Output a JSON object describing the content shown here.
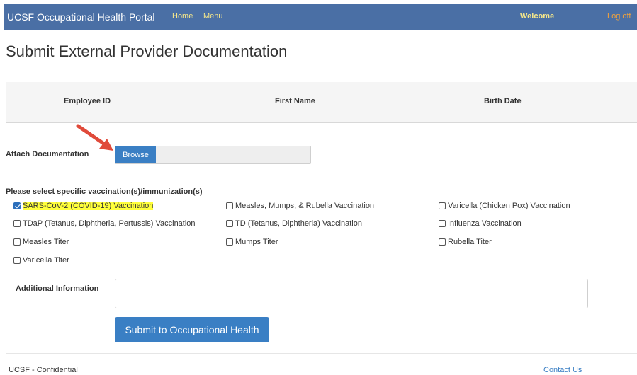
{
  "navbar": {
    "brand": "UCSF Occupational Health Portal",
    "links": [
      "Home",
      "Menu"
    ],
    "welcome": "Welcome",
    "logoff": "Log off"
  },
  "page": {
    "title": "Submit External Provider Documentation"
  },
  "employee_panel": {
    "columns": [
      "Employee ID",
      "First Name",
      "Birth Date"
    ]
  },
  "attach": {
    "label": "Attach Documentation",
    "browse_label": "Browse"
  },
  "vaccinations": {
    "title": "Please select specific vaccination(s)/immunization(s)",
    "items": [
      {
        "label": "SARS-CoV-2 (COVID-19) Vaccination",
        "checked": true
      },
      {
        "label": "Measles, Mumps, & Rubella Vaccination",
        "checked": false
      },
      {
        "label": "Varicella (Chicken Pox) Vaccination",
        "checked": false
      },
      {
        "label": "TDaP (Tetanus, Diphtheria, Pertussis) Vaccination",
        "checked": false
      },
      {
        "label": "TD (Tetanus, Diphtheria) Vaccination",
        "checked": false
      },
      {
        "label": "Influenza Vaccination",
        "checked": false
      },
      {
        "label": "Measles Titer",
        "checked": false
      },
      {
        "label": "Mumps Titer",
        "checked": false
      },
      {
        "label": "Rubella Titer",
        "checked": false
      },
      {
        "label": "Varicella Titer",
        "checked": false
      }
    ]
  },
  "additional": {
    "label": "Additional Information",
    "value": ""
  },
  "submit": {
    "label": "Submit to Occupational Health"
  },
  "footer": {
    "left": "UCSF - Confidential",
    "right": "Contact Us"
  },
  "colors": {
    "navbar": "#4a6fa5",
    "button": "#3a7fc4",
    "highlight": "#ffff3b",
    "arrow": "#e04a3a"
  }
}
